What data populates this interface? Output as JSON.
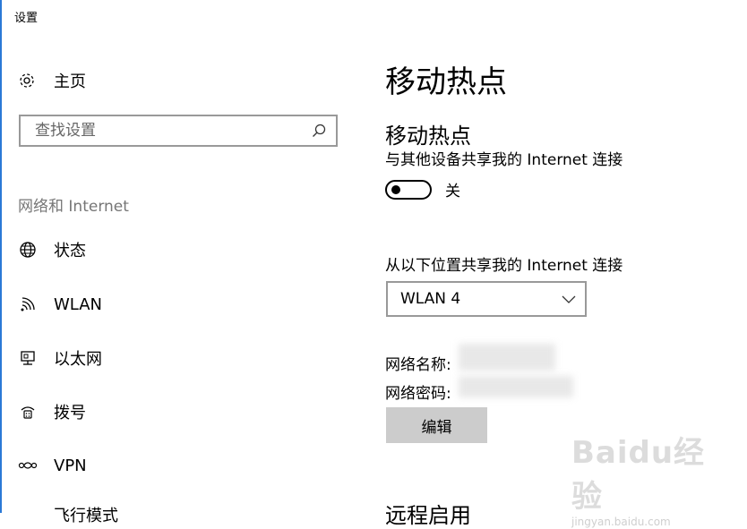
{
  "window": {
    "title": "设置"
  },
  "sidebar": {
    "home": {
      "label": "主页",
      "icon": "gear-icon"
    },
    "search": {
      "placeholder": "查找设置",
      "icon": "search-icon"
    },
    "section": "网络和 Internet",
    "items": [
      {
        "label": "状态",
        "icon": "globe-icon"
      },
      {
        "label": "WLAN",
        "icon": "wifi-icon"
      },
      {
        "label": "以太网",
        "icon": "ethernet-icon"
      },
      {
        "label": "拨号",
        "icon": "dialup-icon"
      },
      {
        "label": "VPN",
        "icon": "vpn-icon"
      },
      {
        "label": "飞行模式",
        "icon": "airplane-icon"
      }
    ]
  },
  "main": {
    "page_title": "移动热点",
    "sub_title": "移动热点",
    "description": "与其他设备共享我的 Internet 连接",
    "toggle": {
      "state_label": "关",
      "on": false
    },
    "share_from": {
      "label": "从以下位置共享我的 Internet 连接",
      "selected": "WLAN 4"
    },
    "network_name_label": "网络名称:",
    "network_password_label": "网络密码:",
    "edit_button": "编辑",
    "next_heading": "远程启用"
  },
  "watermark": {
    "logo": "Baidu经验",
    "sub": "jingyan.baidu.com"
  },
  "colors": {
    "accent": "#2b79d6",
    "button_bg": "#cccccc",
    "border": "#999999",
    "muted": "#767676"
  }
}
